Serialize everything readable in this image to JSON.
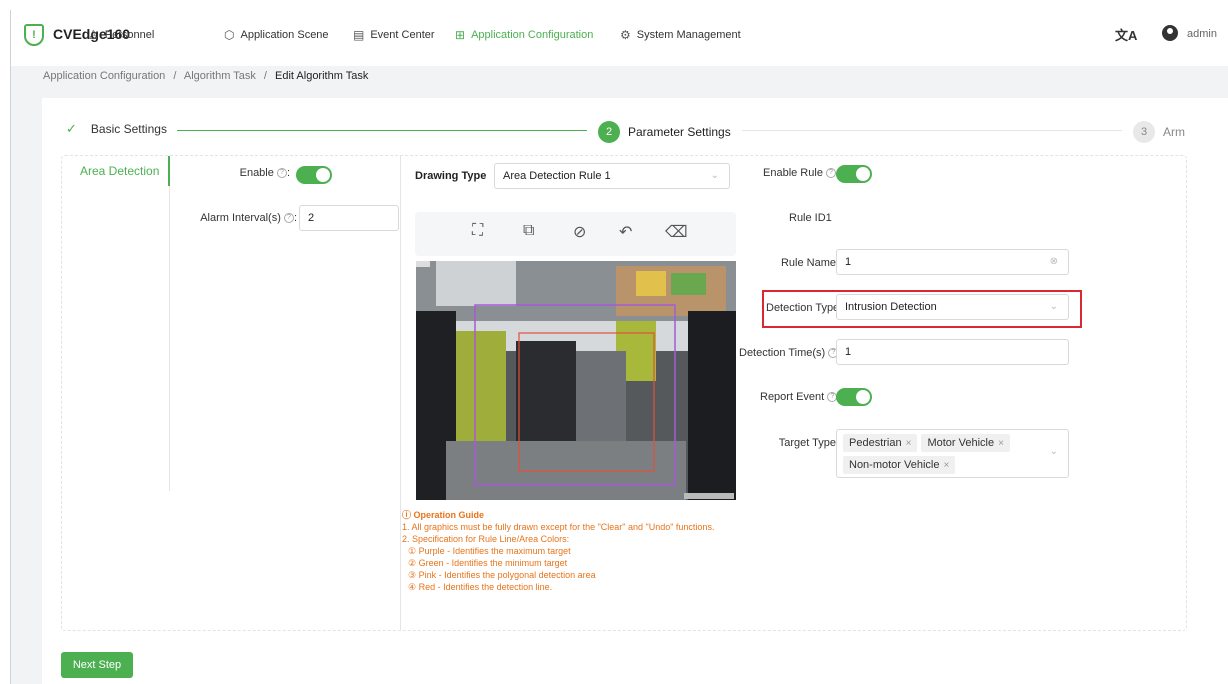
{
  "app": {
    "brand": "CVEdge160",
    "user": "admin"
  },
  "nav": [
    {
      "label": "Personnel",
      "icon": "person-icon"
    },
    {
      "label": "Application Scene",
      "icon": "cube-icon"
    },
    {
      "label": "Event Center",
      "icon": "document-icon"
    },
    {
      "label": "Application Configuration",
      "icon": "grid-icon",
      "active": true
    },
    {
      "label": "System Management",
      "icon": "gear-icon"
    }
  ],
  "breadcrumb": {
    "part1": "Application Configuration",
    "sep": "/",
    "part2": "Algorithm Task",
    "current": "Edit Algorithm Task"
  },
  "steps": [
    {
      "label": "Basic Settings",
      "status": "done"
    },
    {
      "num": "2",
      "label": "Parameter Settings",
      "status": "active"
    },
    {
      "num": "3",
      "label": "Arm",
      "status": "pending"
    }
  ],
  "sidebar": {
    "tab": "Area Detection"
  },
  "left_panel": {
    "enable_label": "Enable",
    "alarm_interval_label": "Alarm Interval(s)",
    "alarm_interval_value": "2"
  },
  "drawing": {
    "type_label": "Drawing Type",
    "type_value": "Area Detection Rule 1"
  },
  "guide": {
    "title": "Operation Guide",
    "line1": "1. All graphics must be fully drawn except for the \"Clear\" and \"Undo\" functions.",
    "line2": "2. Specification for Rule Line/Area Colors:",
    "line3": "① Purple - Identifies the maximum target",
    "line4": "② Green - Identifies the minimum target",
    "line5": "③ Pink - Identifies the polygonal detection area",
    "line6": "④ Red - Identifies the detection line."
  },
  "rule": {
    "enable_rule_label": "Enable Rule",
    "rule_id_text": "Rule ID1",
    "rule_name_label": "Rule Name",
    "rule_name_value": "1",
    "detection_type_label": "Detection Type",
    "detection_type_value": "Intrusion Detection",
    "detection_time_label": "Detection Time(s)",
    "detection_time_value": "1",
    "report_event_label": "Report Event",
    "target_type_label": "Target Type",
    "target_types": [
      "Pedestrian",
      "Motor Vehicle",
      "Non-motor Vehicle"
    ]
  },
  "footer": {
    "next_label": "Next Step"
  },
  "colors": {
    "accent": "#4caf50",
    "highlight": "#d9282f",
    "guide": "#e8741a"
  }
}
